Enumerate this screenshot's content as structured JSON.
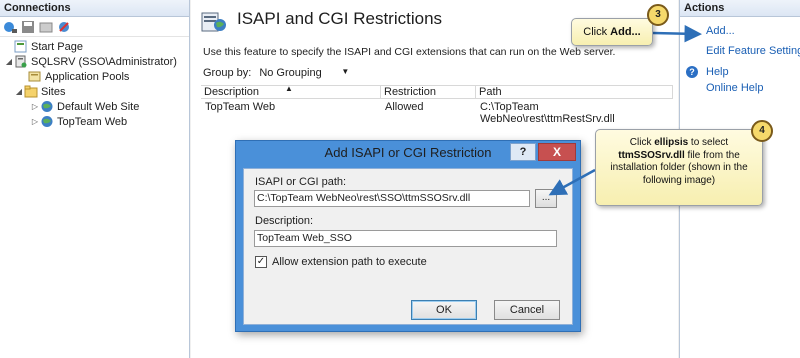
{
  "connections": {
    "header": "Connections",
    "tree": [
      {
        "label": "Start Page",
        "icon": "start-page-icon"
      },
      {
        "label": "SQLSRV (SSO\\Administrator)",
        "icon": "server-icon"
      },
      {
        "label": "Application Pools",
        "icon": "app-pools-icon"
      },
      {
        "label": "Sites",
        "icon": "sites-folder-icon"
      },
      {
        "label": "Default Web Site",
        "icon": "globe-icon"
      },
      {
        "label": "TopTeam Web",
        "icon": "globe-icon"
      }
    ]
  },
  "feature": {
    "title": "ISAPI and CGI Restrictions",
    "description": "Use this feature to specify the ISAPI and CGI extensions that can run on the Web server.",
    "groupby_label": "Group by:",
    "groupby_value": "No Grouping",
    "columns": [
      "Description",
      "Restriction",
      "Path"
    ],
    "rows": [
      {
        "description": "TopTeam Web",
        "restriction": "Allowed",
        "path": "C:\\TopTeam WebNeo\\rest\\ttmRestSrv.dll"
      }
    ]
  },
  "actions": {
    "header": "Actions",
    "add": "Add...",
    "edit_feature_settings": "Edit Feature Settings...",
    "help": "Help",
    "online_help": "Online Help"
  },
  "dialog": {
    "title": "Add ISAPI or CGI Restriction",
    "help_btn": "?",
    "close_btn": "X",
    "path_label": "ISAPI or CGI path:",
    "path_value": "C:\\TopTeam WebNeo\\rest\\SSO\\ttmSSOSrv.dll",
    "ellipsis": "...",
    "desc_label": "Description:",
    "desc_value": "TopTeam Web_SSO",
    "allow_label": "Allow extension path to execute",
    "allow_checked": true,
    "ok": "OK",
    "cancel": "Cancel"
  },
  "callouts": {
    "step3": {
      "badge": "3",
      "text_prefix": "Click ",
      "text_bold": "Add..."
    },
    "step4": {
      "badge": "4",
      "line1_prefix": "Click ",
      "line1_bold": "ellipsis",
      "line1_suffix": " to select",
      "line2_bold": "ttmSSOSrv.dll",
      "line2_suffix": " file from the",
      "line3": "installation folder (shown in the",
      "line4": "following image)"
    }
  },
  "colors": {
    "link": "#1a5fb4",
    "dialog_frame": "#4a90d9",
    "callout_bg": "#fcf5c8",
    "badge": "#f6d96b",
    "arrow": "#2e6fb7"
  }
}
